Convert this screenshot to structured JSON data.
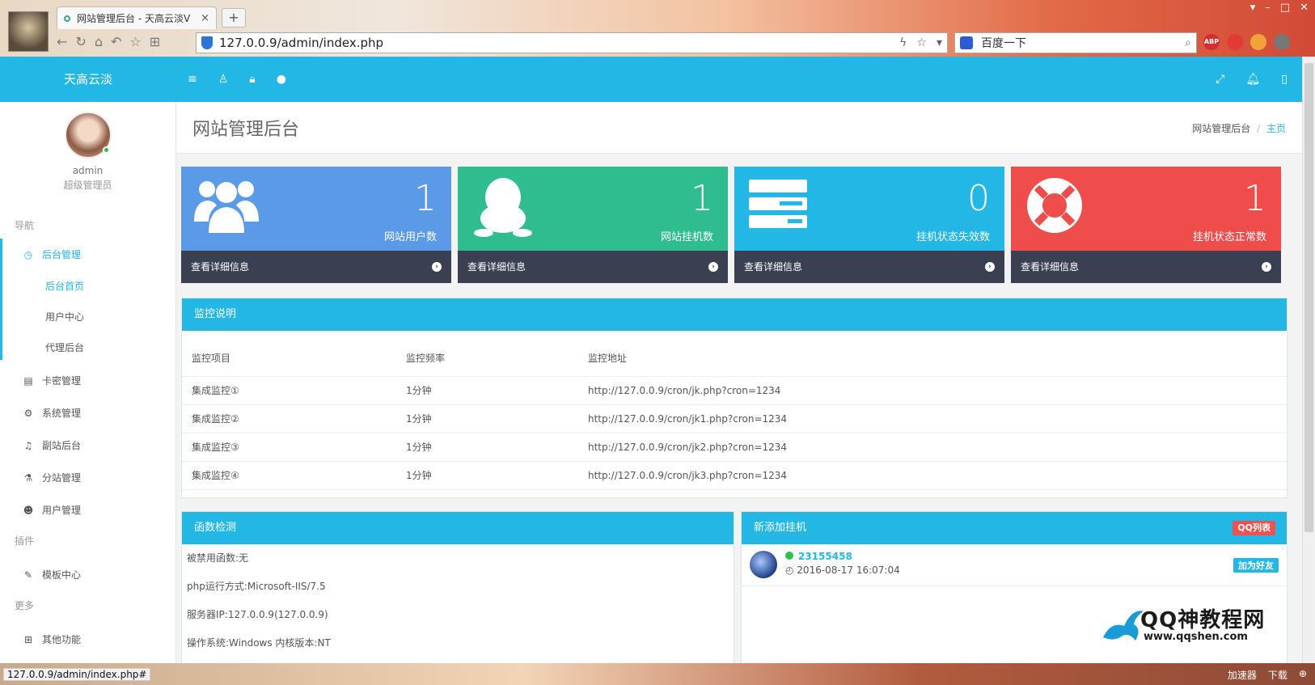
{
  "browser": {
    "tab_title": "网站管理后台 - 天高云淡V",
    "tab_close": "×",
    "new_tab": "+",
    "url": "127.0.0.9/admin/index.php",
    "search_text": "百度一下",
    "status_url": "127.0.0.9/admin/index.php#",
    "status_items": [
      "加速器",
      "下载"
    ]
  },
  "header": {
    "brand": "天高云淡"
  },
  "sidebar": {
    "username": "admin",
    "role": "超级管理员",
    "section_nav": "导航",
    "section_plugin": "插件",
    "section_more": "更多",
    "items": [
      {
        "label": "后台管理",
        "icon": "dashboard-icon"
      },
      {
        "label": "卡密管理",
        "icon": "list-icon"
      },
      {
        "label": "系统管理",
        "icon": "gear-icon"
      },
      {
        "label": "副站后台",
        "icon": "bell-icon"
      },
      {
        "label": "分站管理",
        "icon": "flask-icon"
      },
      {
        "label": "用户管理",
        "icon": "users-icon"
      },
      {
        "label": "模板中心",
        "icon": "edit-icon"
      },
      {
        "label": "其他功能",
        "icon": "grid-icon"
      }
    ],
    "sub_items": [
      "后台首页",
      "用户中心",
      "代理后台"
    ]
  },
  "page": {
    "title": "网站管理后台",
    "breadcrumb_root": "网站管理后台",
    "breadcrumb_sep": "/",
    "breadcrumb_current": "主页"
  },
  "stats": [
    {
      "value": "1",
      "label": "网站用户数",
      "link": "查看详细信息",
      "color": "#5b9ae6",
      "icon": "users-icon"
    },
    {
      "value": "1",
      "label": "网站挂机数",
      "link": "查看详细信息",
      "color": "#2fbc8e",
      "icon": "qq-penguin-icon"
    },
    {
      "value": "0",
      "label": "挂机状态失效数",
      "link": "查看详细信息",
      "color": "#23b7e5",
      "icon": "server-icon"
    },
    {
      "value": "1",
      "label": "挂机状态正常数",
      "link": "查看详细信息",
      "color": "#ef4c4c",
      "icon": "lifebuoy-icon"
    }
  ],
  "monitor": {
    "title": "监控说明",
    "headers": [
      "监控项目",
      "监控频率",
      "监控地址"
    ],
    "rows": [
      [
        "集成监控①",
        "1分钟",
        "http://127.0.0.9/cron/jk.php?cron=1234"
      ],
      [
        "集成监控②",
        "1分钟",
        "http://127.0.0.9/cron/jk1.php?cron=1234"
      ],
      [
        "集成监控③",
        "1分钟",
        "http://127.0.0.9/cron/jk2.php?cron=1234"
      ],
      [
        "集成监控④",
        "1分钟",
        "http://127.0.0.9/cron/jk3.php?cron=1234"
      ]
    ]
  },
  "functions": {
    "title": "函数检测",
    "lines": [
      "被禁用函数:无",
      "php运行方式:Microsoft-IIS/7.5",
      "服务器IP:127.0.0.9(127.0.0.9)",
      "操作系统:Windows  内核版本:NT"
    ]
  },
  "new_hosts": {
    "title": "新添加挂机",
    "badge": "QQ列表",
    "entry": {
      "qq": "23155458",
      "time": "2016-08-17 16:07:04",
      "action": "加为好友"
    }
  },
  "watermark": {
    "line1": "QQ神教程网",
    "line2": "www.qqshen.com"
  }
}
